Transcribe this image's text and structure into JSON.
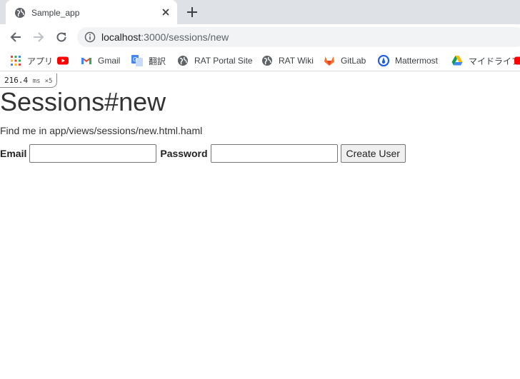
{
  "browser": {
    "tab": {
      "title": "Sample_app"
    },
    "address": {
      "host": "localhost",
      "rest": ":3000/sessions/new"
    },
    "bookmarks": [
      {
        "label": "アプリ",
        "icon": "apps-grid-icon"
      },
      {
        "label": "",
        "icon": "youtube-icon"
      },
      {
        "label": "Gmail",
        "icon": "gmail-icon"
      },
      {
        "label": "翻訳",
        "icon": "translate-icon"
      },
      {
        "label": "RAT Portal Site",
        "icon": "globe-icon"
      },
      {
        "label": "RAT Wiki",
        "icon": "globe-icon"
      },
      {
        "label": "GitLab",
        "icon": "gitlab-icon"
      },
      {
        "label": "Mattermost",
        "icon": "mattermost-icon"
      },
      {
        "label": "マイドライブ",
        "icon": "google-drive-icon"
      }
    ]
  },
  "profiler": {
    "time": "216.4",
    "unit": "ms",
    "count": "×5"
  },
  "page": {
    "heading": "Sessions#new",
    "subtext": "Find me in app/views/sessions/new.html.haml",
    "form": {
      "email_label": "Email",
      "email_value": "",
      "password_label": "Password",
      "password_value": "",
      "submit_label": "Create User"
    }
  },
  "colors": {
    "tabstrip": "#dee1e6",
    "omnibox": "#f1f3f4",
    "youtube": "#ff0000",
    "gitlab": "#e24329",
    "mattermost": "#1e5de6"
  }
}
